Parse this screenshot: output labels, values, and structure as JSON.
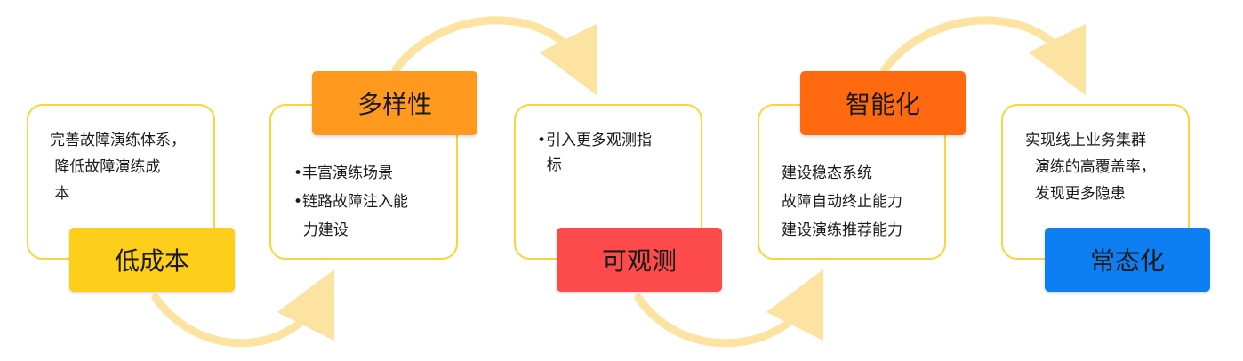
{
  "stages": [
    {
      "id": "low-cost",
      "label": "低成本",
      "color": "#fdcf1a",
      "lines": [
        "完善故障演练体系，",
        " 降低故障演练成",
        " 本"
      ]
    },
    {
      "id": "diversity",
      "label": "多样性",
      "color": "#ff9a1f",
      "bullets": [
        "•丰富演练场景",
        "•链路故障注入能",
        "  力建设"
      ]
    },
    {
      "id": "observable",
      "label": "可观测",
      "color": "#fd4b4b",
      "bullets": [
        "•引入更多观测指",
        "  标"
      ]
    },
    {
      "id": "intelligent",
      "label": "智能化",
      "color": "#ff6a10",
      "lines": [
        "建设稳态系统",
        "故障自动终止能力",
        "建设演练推荐能力"
      ]
    },
    {
      "id": "normalized",
      "label": "常态化",
      "color": "#0d7ff3",
      "lines": [
        "实现线上业务集群",
        "  演练的高覆盖率，",
        "  发现更多隐患"
      ]
    }
  ],
  "arrow_color": "#fde3a2"
}
